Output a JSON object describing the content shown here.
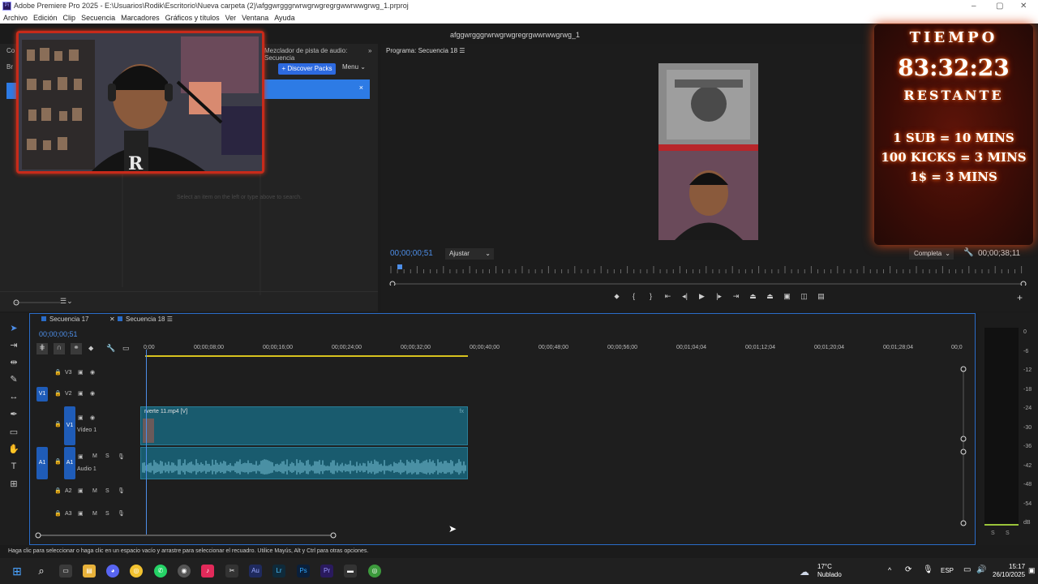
{
  "window": {
    "title": "Adobe Premiere Pro 2025 - E:\\Usuarios\\Rodik\\Escritorio\\Nueva carpeta (2)\\afggwrgggrwrwgrwgregrgwwrwwgrwg_1.prproj",
    "project_name": "afggwrgggrwrwgrwgregrgwwrwwgrwg_1",
    "app_icon": "Pr"
  },
  "menu": [
    "Archivo",
    "Edición",
    "Clip",
    "Secuencia",
    "Marcadores",
    "Gráficos y títulos",
    "Ver",
    "Ventana",
    "Ayuda"
  ],
  "left_panel": {
    "tab_audio_mixer": "Mezclador de pista de audio: Secuencia",
    "tab_cut_a": "Co",
    "tab_cut_b": "Br",
    "discover_label": "+ Discover Packs",
    "menu_label": "Menu",
    "close_glyph": "×",
    "empty_hint": "Select an item on the left or type above to search."
  },
  "program_monitor": {
    "title": "Programa: Secuencia 18",
    "current_time": "00;00;00;51",
    "fit_label": "Ajustar",
    "quality_label": "Completa",
    "duration": "00;00;38;11"
  },
  "overlay": {
    "title": "TIEMPO",
    "countdown": "83:32:23",
    "remaining": "RESTANTE",
    "rule_1": "1 SUB = 10 MINS",
    "rule_2": "100 KICKS = 3 MINS",
    "rule_3": "1$ = 3 MINS"
  },
  "timeline": {
    "tabs": [
      "Secuencia 17",
      "Secuencia 18"
    ],
    "current_time": "00;00;00;51",
    "ruler_labels": [
      "0;00",
      "00;00;08;00",
      "00;00;16;00",
      "00;00;24;00",
      "00;00;32;00",
      "00;00;40;00",
      "00;00;48;00",
      "00;00;56;00",
      "00;01;04;04",
      "00;01;12;04",
      "00;01;20;04",
      "00;01;28;04",
      "00;0"
    ],
    "tracks": {
      "v3": "V3",
      "v2": "V2",
      "v1": "V1",
      "v1_name": "Vídeo 1",
      "a1": "A1",
      "a1_name": "Audio 1",
      "a2": "A2",
      "a3": "A3",
      "mute": "M",
      "solo": "S"
    },
    "video_clip": "rverte 11.mp4 [V]",
    "meter_labels": [
      "0",
      "-6",
      "-12",
      "-18",
      "-24",
      "-30",
      "-36",
      "-42",
      "-48",
      "-54",
      "dB"
    ],
    "meter_footer": [
      "S",
      "S"
    ]
  },
  "status_bar": "Haga clic para seleccionar o haga clic en un espacio vacío y arrastre para seleccionar el recuadro. Utilice Mayús, Alt y Ctrl para otras opciones.",
  "taskbar": {
    "weather_temp": "17°C",
    "weather_desc": "Nublado",
    "language": "ESP",
    "time": "15:17",
    "date": "26/10/2025",
    "app_labels": {
      "audition": "Au",
      "lightroom": "Lr",
      "photoshop": "Ps",
      "premiere": "Pr"
    }
  },
  "colors": {
    "accent_blue": "#2d7be5",
    "clip_teal": "#195b6e",
    "overlay_fire": "#d44314"
  }
}
